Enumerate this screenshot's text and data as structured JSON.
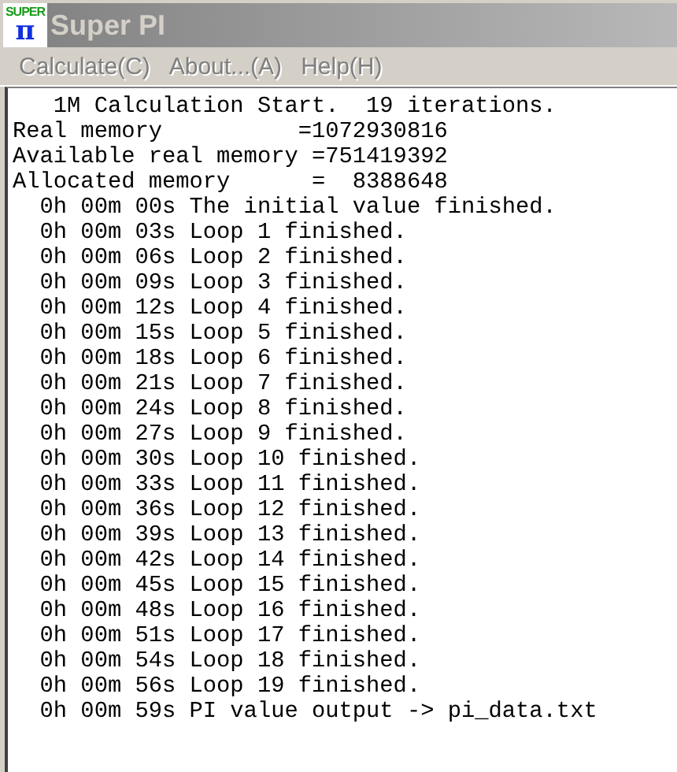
{
  "window": {
    "title": "Super PI",
    "logo_text": "SUPER",
    "logo_symbol": "π",
    "active": false
  },
  "menu": [
    {
      "label": "Calculate(C)",
      "disabled": true
    },
    {
      "label": "About...(A)",
      "disabled": true
    },
    {
      "label": "Help(H)",
      "disabled": true
    }
  ],
  "log_lines": [
    "   1M Calculation Start.  19 iterations.",
    "Real memory          =1072930816",
    "Available real memory =751419392",
    "Allocated memory      =  8388648",
    "  0h 00m 00s The initial value finished.",
    "  0h 00m 03s Loop 1 finished.",
    "  0h 00m 06s Loop 2 finished.",
    "  0h 00m 09s Loop 3 finished.",
    "  0h 00m 12s Loop 4 finished.",
    "  0h 00m 15s Loop 5 finished.",
    "  0h 00m 18s Loop 6 finished.",
    "  0h 00m 21s Loop 7 finished.",
    "  0h 00m 24s Loop 8 finished.",
    "  0h 00m 27s Loop 9 finished.",
    "  0h 00m 30s Loop 10 finished.",
    "  0h 00m 33s Loop 11 finished.",
    "  0h 00m 36s Loop 12 finished.",
    "  0h 00m 39s Loop 13 finished.",
    "  0h 00m 42s Loop 14 finished.",
    "  0h 00m 45s Loop 15 finished.",
    "  0h 00m 48s Loop 16 finished.",
    "  0h 00m 51s Loop 17 finished.",
    "  0h 00m 54s Loop 18 finished.",
    "  0h 00m 56s Loop 19 finished.",
    "  0h 00m 59s PI value output -> pi_data.txt"
  ]
}
